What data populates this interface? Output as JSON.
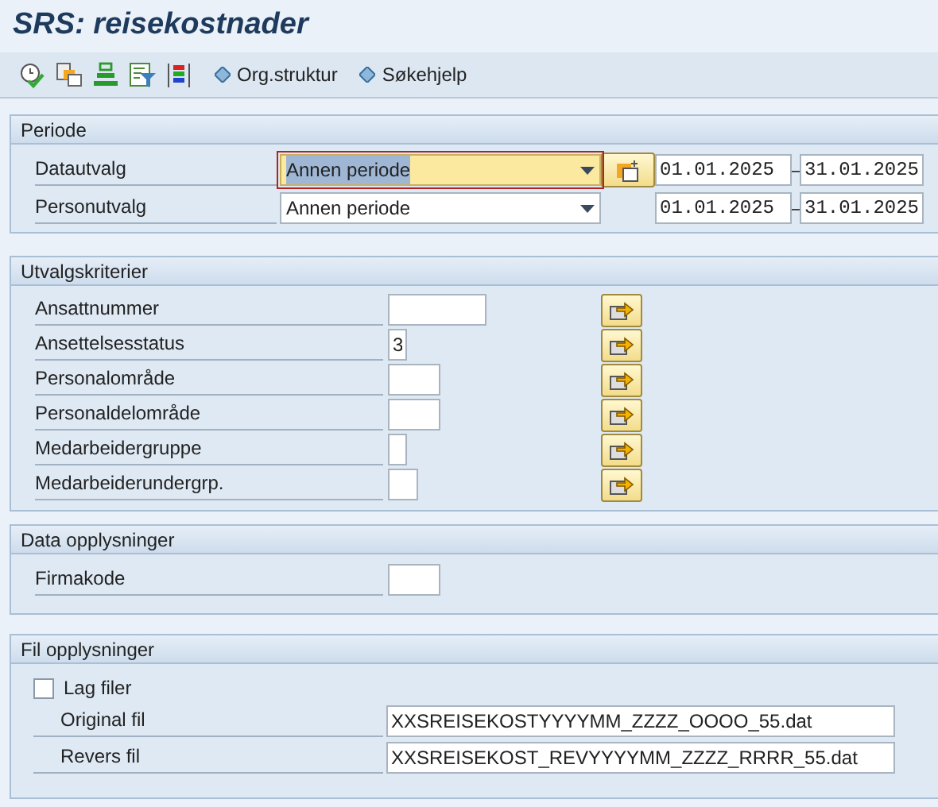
{
  "title": "SRS: reisekostnader",
  "toolbar": {
    "links": [
      "Org.struktur",
      "Søkehjelp"
    ]
  },
  "periode": {
    "title": "Periode",
    "rows": [
      {
        "label": "Datautvalg",
        "value": "Annen periode",
        "focused": true,
        "button": true,
        "from": "01.01.2025",
        "dash": "–",
        "to": "31.01.2025"
      },
      {
        "label": "Personutvalg",
        "value": "Annen periode",
        "focused": false,
        "button": false,
        "from": "01.01.2025",
        "dash": "–",
        "to": "31.01.2025"
      }
    ]
  },
  "criteria": {
    "title": "Utvalgskriterier",
    "rows": [
      {
        "label": "Ansattnummer",
        "value": ""
      },
      {
        "label": "Ansettelsesstatus",
        "value": "3"
      },
      {
        "label": "Personalområde",
        "value": ""
      },
      {
        "label": "Personaldelområde",
        "value": ""
      },
      {
        "label": "Medarbeidergruppe",
        "value": ""
      },
      {
        "label": "Medarbeiderundergrp.",
        "value": ""
      }
    ]
  },
  "data": {
    "title": "Data opplysninger",
    "rows": [
      {
        "label": "Firmakode",
        "value": ""
      }
    ]
  },
  "files": {
    "title": "Fil opplysninger",
    "checkbox": {
      "label": "Lag filer",
      "checked": false
    },
    "rows": [
      {
        "label": "Original fil",
        "value": "XXSREISEKOSTYYYYMM_ZZZZ_OOOO_55.dat"
      },
      {
        "label": "Revers fil",
        "value": "XXSREISEKOST_REVYYYYMM_ZZZZ_RRRR_55.dat"
      }
    ]
  }
}
